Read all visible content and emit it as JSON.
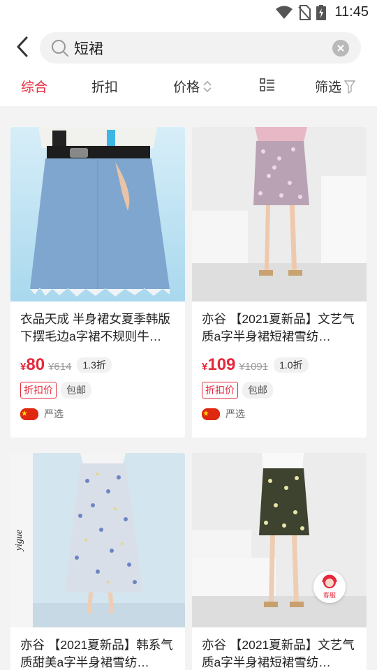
{
  "status_bar": {
    "time": "11:45"
  },
  "search": {
    "query": "短裙"
  },
  "sort_tabs": [
    {
      "label": "综合",
      "active": true
    },
    {
      "label": "折扣",
      "active": false
    },
    {
      "label": "价格",
      "active": false
    },
    {
      "label": "",
      "icon": "list-layout-icon"
    },
    {
      "label": "筛选",
      "active": false
    }
  ],
  "products": [
    {
      "title": "衣品天成 半身裙女夏季韩版下摆毛边a字裙不规则牛…",
      "price_currency": "¥",
      "price": "80",
      "original_price": "¥614",
      "discount": "1.3折",
      "tags": [
        "折扣价",
        "包邮"
      ],
      "origin": "严选"
    },
    {
      "title": "亦谷 【2021夏新品】文艺气质a字半身裙短裙雪纺…",
      "price_currency": "¥",
      "price": "109",
      "original_price": "¥1091",
      "discount": "1.0折",
      "tags": [
        "折扣价",
        "包邮"
      ],
      "origin": "严选"
    },
    {
      "title": "亦谷 【2021夏新品】韩系气质甜美a字半身裙雪纺…",
      "image_text": "yigue"
    },
    {
      "title": "亦谷 【2021夏新品】文艺气质a字半身裙短裙雪纺…"
    }
  ],
  "service_button": {
    "label": "客服"
  },
  "colors": {
    "accent": "#e5293d",
    "background": "#f3f3f3"
  }
}
